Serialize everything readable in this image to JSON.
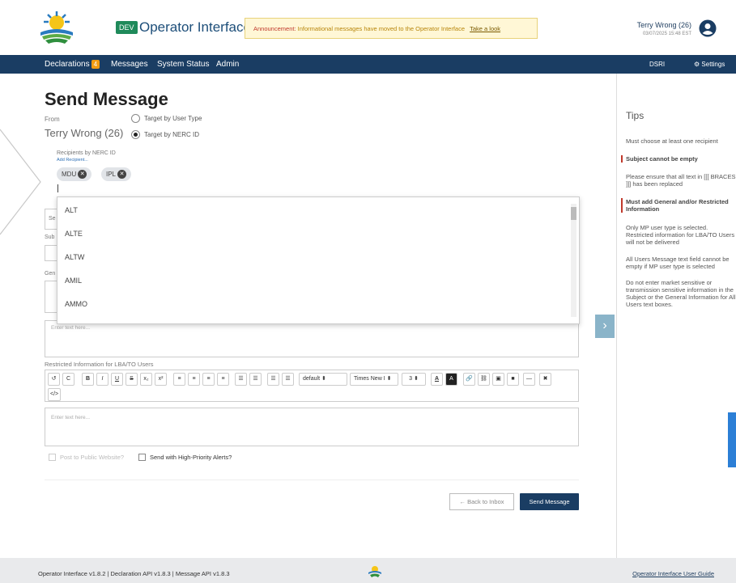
{
  "header": {
    "env_badge": "DEV",
    "app_title": "Operator Interface",
    "announcement_label": "Announcement:",
    "announcement_text": "Informational messages have moved to the Operator Interface",
    "announcement_link": "Take a look",
    "user_name": "Terry Wrong (26)",
    "user_datetime": "03/07/2025 15:48 EST"
  },
  "nav": {
    "declarations": "Declarations",
    "declarations_count": "4",
    "messages": "Messages",
    "system_status": "System Status",
    "admin": "Admin",
    "dsri": "DSRI",
    "settings": "Settings"
  },
  "form": {
    "title": "Send Message",
    "from_label": "From",
    "from_value": "Terry Wrong (26)",
    "target_user_type": "Target by User Type",
    "target_nerc_id": "Target by NERC ID",
    "recipients_label": "Recipients by NERC ID",
    "add_recipient": "Add Recipient...",
    "chips": [
      "MDU",
      "IPL"
    ],
    "dropdown_options": [
      "ALT",
      "ALTE",
      "ALTW",
      "AMIL",
      "AMMO"
    ],
    "hidden_subject_label": "Sub",
    "hidden_general_label": "Gen",
    "hidden_sel": "Se",
    "general_placeholder": "Enter text here...",
    "restricted_label": "Restricted Information for LBA/TO Users",
    "restricted_placeholder": "Enter text here...",
    "post_public": "Post to Public Website?",
    "high_priority": "Send with High-Priority Alerts?",
    "back_button": "← Back to Inbox",
    "send_button": "Send Message"
  },
  "toolbar": {
    "buttons": [
      "↺",
      "C",
      "B",
      "I",
      "U",
      "S",
      "x₂",
      "x²",
      "≡",
      "≡",
      "≡",
      "≡",
      "☰",
      "☰",
      "☰",
      "☰"
    ],
    "format_select": "default",
    "font_select": "Times New I",
    "size_select": "3",
    "code_button": "</>"
  },
  "tips": {
    "title": "Tips",
    "items": [
      "Must choose at least one recipient",
      "Subject cannot be empty",
      "Please ensure that all text in [[[ BRACES ]]] has been replaced",
      "Must add General and/or Restricted Information",
      "Only MP user type is selected. Restricted information for LBA/TO Users will not be delivered",
      "All Users Message text field cannot be empty if MP user type is selected",
      "Do not enter market sensitive or transmission sensitive information in the Subject or the General Information for All Users text boxes."
    ]
  },
  "footer": {
    "versions": "Operator Interface v1.8.2 | Declaration API v1.8.3 | Message API v1.8.3",
    "guide_link": "Operator Interface User Guide"
  }
}
